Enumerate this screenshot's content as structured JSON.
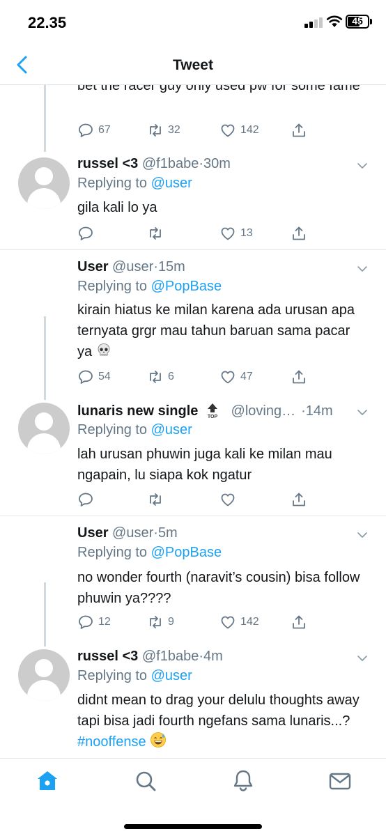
{
  "status_bar": {
    "time": "22.35",
    "battery_level": "45"
  },
  "header": {
    "title": "Tweet"
  },
  "tweets": [
    {
      "text": "bet the racer guy only used pw for some fame",
      "replies": "67",
      "retweets": "32",
      "likes": "142"
    },
    {
      "name": "russel <3",
      "handle": "@f1babe",
      "time": "30m",
      "replying_label": "Replying to",
      "replying_to": "@user",
      "text": "gila kali lo ya",
      "replies": "",
      "retweets": "",
      "likes": "13"
    },
    {
      "name": "User",
      "handle": "@user",
      "time": "15m",
      "replying_label": "Replying to",
      "replying_to": "@PopBase",
      "text": "kirain hiatus ke milan karena ada urusan apa ternyata grgr mau tahun baruan sama pacar ya",
      "emoji": "skull",
      "replies": "54",
      "retweets": "6",
      "likes": "47"
    },
    {
      "name": "lunaris new single",
      "badge": "TOP",
      "handle": "@loving…",
      "time": "14m",
      "replying_label": "Replying to",
      "replying_to": "@user",
      "text": "lah urusan phuwin juga kali ke milan mau ngapain, lu siapa kok ngatur",
      "replies": "",
      "retweets": "",
      "likes": ""
    },
    {
      "name": "User",
      "handle": "@user",
      "time": "5m",
      "replying_label": "Replying to",
      "replying_to": "@PopBase",
      "text": "no wonder fourth (naravit’s cousin) bisa follow phuwin ya????",
      "replies": "12",
      "retweets": "9",
      "likes": "142"
    },
    {
      "name": "russel <3",
      "handle": "@f1babe",
      "time": "4m",
      "replying_label": "Replying to",
      "replying_to": "@user",
      "text": "didnt mean to drag your delulu thoughts away tapi bisa jadi fourth ngefans sama lunaris...?",
      "hashtag": "#nooffense",
      "emoji": "grinning-sweat",
      "replies": "",
      "retweets": "",
      "likes": ""
    }
  ],
  "tab_bar": {
    "items": [
      "home-icon",
      "search-icon",
      "notifications-icon",
      "messages-icon"
    ],
    "active": "home-icon"
  },
  "colors": {
    "accent": "#1da1f2",
    "text": "#14171a",
    "muted": "#657786",
    "divider": "#e1e8ed",
    "avatar": "#cccccc"
  }
}
